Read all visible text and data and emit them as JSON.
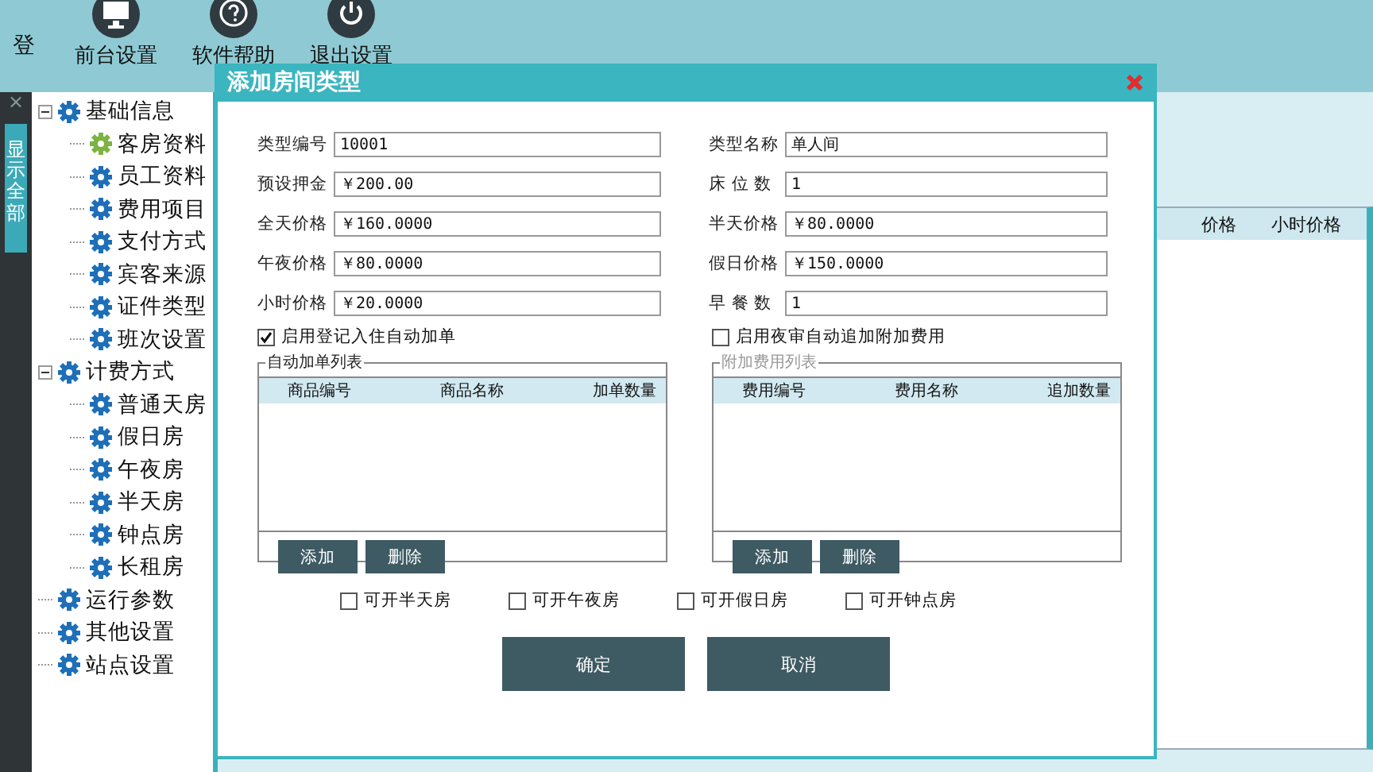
{
  "toolbar": {
    "cut_label": "登",
    "buttons": [
      {
        "label": "前台设置"
      },
      {
        "label": "软件帮助"
      },
      {
        "label": "退出设置"
      }
    ]
  },
  "side_strip": {
    "close": "×",
    "tab": "显示全部"
  },
  "tree": [
    {
      "label": "基础信息",
      "expanded": true,
      "selected": false,
      "children": [
        {
          "label": "客房资料",
          "selected": true
        },
        {
          "label": "员工资料",
          "selected": false
        },
        {
          "label": "费用项目",
          "selected": false
        },
        {
          "label": "支付方式",
          "selected": false
        },
        {
          "label": "宾客来源",
          "selected": false
        },
        {
          "label": "证件类型",
          "selected": false
        },
        {
          "label": "班次设置",
          "selected": false
        }
      ]
    },
    {
      "label": "计费方式",
      "expanded": true,
      "selected": false,
      "children": [
        {
          "label": "普通天房",
          "selected": false
        },
        {
          "label": "假日房",
          "selected": false
        },
        {
          "label": "午夜房",
          "selected": false
        },
        {
          "label": "半天房",
          "selected": false
        },
        {
          "label": "钟点房",
          "selected": false
        },
        {
          "label": "长租房",
          "selected": false
        }
      ]
    },
    {
      "label": "运行参数",
      "selected": false
    },
    {
      "label": "其他设置",
      "selected": false
    },
    {
      "label": "站点设置",
      "selected": false
    }
  ],
  "background_table": {
    "columns": [
      "价格",
      "小时价格"
    ]
  },
  "dialog": {
    "title": "添加房间类型",
    "fields_left": [
      {
        "label": "类型编号",
        "value": "10001"
      },
      {
        "label": "预设押金",
        "value": "￥200.00"
      },
      {
        "label": "全天价格",
        "value": "￥160.0000"
      },
      {
        "label": "午夜价格",
        "value": "￥80.0000"
      },
      {
        "label": "小时价格",
        "value": "￥20.0000"
      }
    ],
    "fields_right": [
      {
        "label": "类型名称",
        "value": "单人间"
      },
      {
        "label": "床 位 数",
        "value": "1"
      },
      {
        "label": "半天价格",
        "value": "￥80.0000"
      },
      {
        "label": "假日价格",
        "value": "￥150.0000"
      },
      {
        "label": "早 餐 数",
        "value": "1"
      }
    ],
    "groups": [
      {
        "option": {
          "label": "启用登记入住自动加单",
          "checked": true
        },
        "legend": "自动加单列表",
        "disabled": false,
        "columns": [
          "商品编号",
          "商品名称",
          "加单数量"
        ],
        "buttons": [
          "添加",
          "删除"
        ]
      },
      {
        "option": {
          "label": "启用夜审自动追加附加费用",
          "checked": false
        },
        "legend": "附加费用列表",
        "disabled": true,
        "columns": [
          "费用编号",
          "费用名称",
          "追加数量"
        ],
        "buttons": [
          "添加",
          "删除"
        ]
      }
    ],
    "options": [
      {
        "label": "可开半天房",
        "checked": false
      },
      {
        "label": "可开午夜房",
        "checked": false
      },
      {
        "label": "可开假日房",
        "checked": false
      },
      {
        "label": "可开钟点房",
        "checked": false
      }
    ],
    "buttons": [
      "确定",
      "取消"
    ]
  }
}
